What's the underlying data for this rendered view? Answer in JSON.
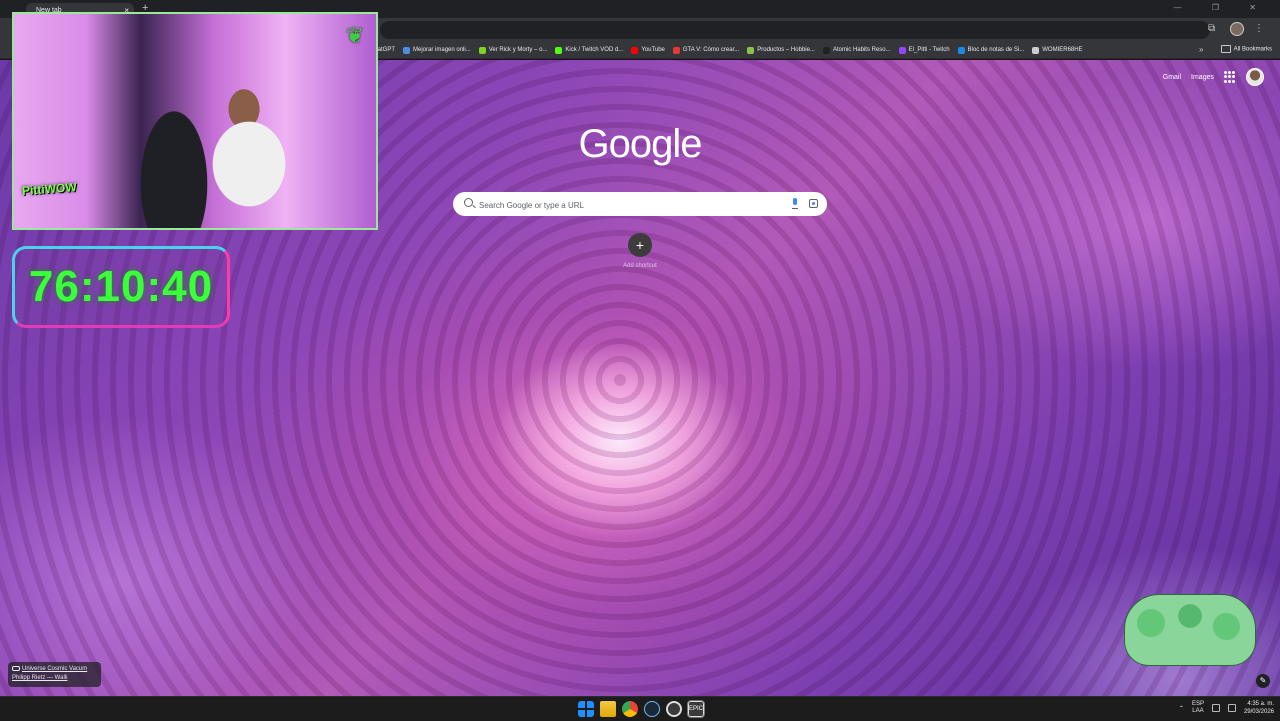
{
  "browser": {
    "tab_title": "New tab",
    "tab_close": "×",
    "new_tab": "+",
    "window_controls": "—  ❐  ✕"
  },
  "bookmarks": {
    "items": [
      {
        "label": "ChatGPT",
        "color": "#ffffff"
      },
      {
        "label": "Mejorar imagen onli...",
        "color": "#4a90e2"
      },
      {
        "label": "Ver Rick y Morty – o...",
        "color": "#7ed321"
      },
      {
        "label": "Kick / Twitch VOD d...",
        "color": "#53fc18"
      },
      {
        "label": "YouTube",
        "color": "#ff0000"
      },
      {
        "label": "GTA V: Cómo crear...",
        "color": "#e53935"
      },
      {
        "label": "Productos – Hobbie...",
        "color": "#8bc34a"
      },
      {
        "label": "Atomic Habits Reso...",
        "color": "#222222"
      },
      {
        "label": "El_Pitti - Twitch",
        "color": "#9146ff"
      },
      {
        "label": "Bloc de notas de Si...",
        "color": "#1e88e5"
      },
      {
        "label": "WOMIER68HE",
        "color": "#cccccc"
      }
    ],
    "more": "»",
    "all_bookmarks": "All Bookmarks"
  },
  "ntp": {
    "gmail": "Gmail",
    "images": "Images",
    "logo": "Google",
    "search_placeholder": "Search Google or type a URL",
    "add_shortcut_icon": "+",
    "add_shortcut_label": "Add shortcut",
    "attribution_title": "Universe Cosmic Vacum",
    "attribution_author": "Philipp Rietz — Walli",
    "edit_icon": "✎"
  },
  "overlay": {
    "timer": "76:10:40",
    "streamer_logo": "PittiWOW",
    "leaf_icon": "❦"
  },
  "taskbar": {
    "epic_label": "EPIC",
    "language": "ESP",
    "language_sub": "LAA",
    "time": "4:35 a. m.",
    "date": "29/03/2026"
  }
}
